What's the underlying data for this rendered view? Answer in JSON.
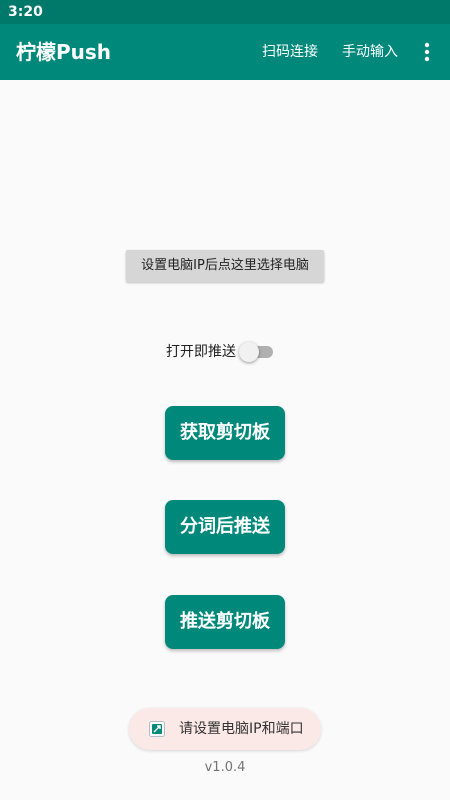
{
  "status_bar": {
    "time": "3:20"
  },
  "app_bar": {
    "title": "柠檬Push",
    "actions": {
      "scan_connect": "扫码连接",
      "manual_input": "手动输入"
    },
    "overflow_icon": "more-vert-icon"
  },
  "main": {
    "select_pc_button": "设置电脑IP后点这里选择电脑",
    "auto_push": {
      "label": "打开即推送",
      "checked": false
    },
    "buttons": {
      "get_clipboard": "获取剪切板",
      "segment_push": "分词后推送",
      "push_clipboard": "推送剪切板"
    }
  },
  "toast": {
    "icon": "app-icon",
    "text": "请设置电脑IP和端口"
  },
  "footer": {
    "version": "v1.0.4"
  },
  "colors": {
    "status_bar": "#00796b",
    "app_bar": "#00897b",
    "primary_button": "#00897b",
    "toast_background": "#fbe9e7"
  }
}
